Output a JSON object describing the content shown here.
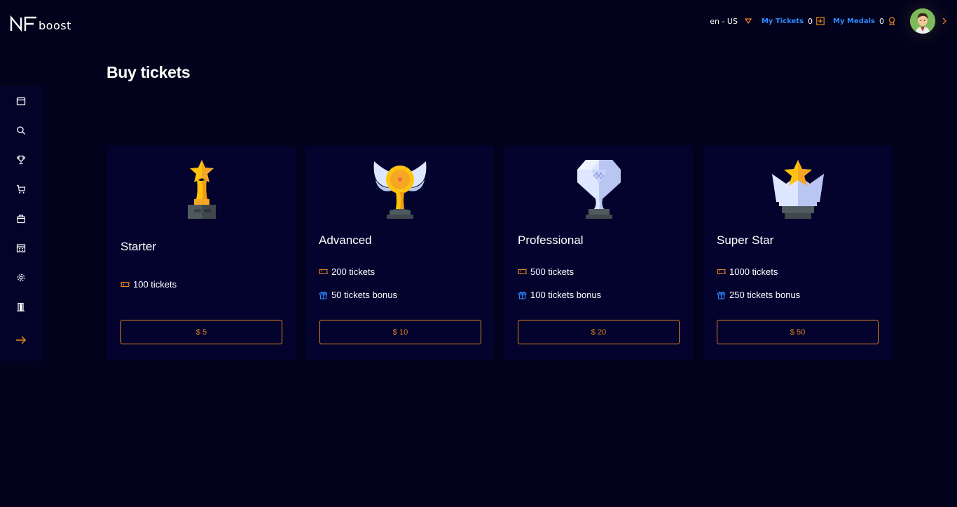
{
  "header": {
    "logo_text": "boost",
    "language": "en - US",
    "my_tickets_label": "My Tickets",
    "my_tickets_value": "0",
    "my_medals_label": "My Medals",
    "my_medals_value": "0"
  },
  "sidebar": {
    "items": [
      {
        "icon": "calendar-icon"
      },
      {
        "icon": "search-icon"
      },
      {
        "icon": "trophy-icon"
      },
      {
        "icon": "cart-icon"
      },
      {
        "icon": "shopping-bag-icon"
      },
      {
        "icon": "dashboard-icon"
      },
      {
        "icon": "gear-icon"
      },
      {
        "icon": "exit-door-icon"
      },
      {
        "icon": "arrow-right-icon"
      }
    ]
  },
  "page": {
    "title": "Buy tickets"
  },
  "packages": [
    {
      "name": "Starter",
      "tickets": "100 tickets",
      "bonus": null,
      "price": "$ 5",
      "trophy": "gold-star-trophy-icon"
    },
    {
      "name": "Advanced",
      "tickets": "200 tickets",
      "bonus": "50 tickets bonus",
      "price": "$ 10",
      "trophy": "winged-medal-trophy-icon"
    },
    {
      "name": "Professional",
      "tickets": "500 tickets",
      "bonus": "100 tickets bonus",
      "price": "$ 20",
      "trophy": "diamond-trophy-icon"
    },
    {
      "name": "Super Star",
      "tickets": "1000 tickets",
      "bonus": "250 tickets bonus",
      "price": "$ 50",
      "trophy": "crystal-star-trophy-icon"
    }
  ],
  "colors": {
    "background": "#02021c",
    "card": "#03032e",
    "accent_orange": "#e8871e",
    "accent_blue": "#2d8cff"
  }
}
